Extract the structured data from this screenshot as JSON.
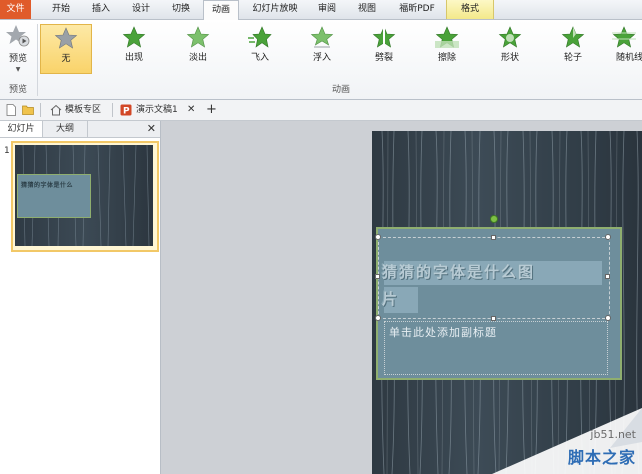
{
  "menu_tabs": [
    {
      "label": "文件"
    },
    {
      "label": "开始"
    },
    {
      "label": "插入"
    },
    {
      "label": "设计"
    },
    {
      "label": "切换"
    },
    {
      "label": "动画"
    },
    {
      "label": "幻灯片放映"
    },
    {
      "label": "审阅"
    },
    {
      "label": "视图"
    },
    {
      "label": "福昕PDF"
    },
    {
      "label": "格式"
    }
  ],
  "ribbon": {
    "preview_label": "预览",
    "preview_group": "预览",
    "animation_group": "动画",
    "effects": [
      {
        "label": "无"
      },
      {
        "label": "出现"
      },
      {
        "label": "淡出"
      },
      {
        "label": "飞入"
      },
      {
        "label": "浮入"
      },
      {
        "label": "劈裂"
      },
      {
        "label": "擦除"
      },
      {
        "label": "形状"
      },
      {
        "label": "轮子"
      },
      {
        "label": "随机线"
      }
    ],
    "colors": {
      "star": "#4aa23a",
      "star_none": "#9aa0a6",
      "selected": "#f9d36a"
    }
  },
  "doc_tabs": {
    "home_label": "模板专区",
    "doc_label": "演示文稿1",
    "add_label": "+"
  },
  "left_pane": {
    "tabs": [
      {
        "label": "幻灯片"
      },
      {
        "label": "大纲"
      }
    ],
    "close": "✕",
    "slide_number": "1",
    "thumb_title": "猜猜的字体是什么"
  },
  "slide": {
    "title_line1": "猜猜的字体是什么图",
    "title_line2": "片",
    "subtitle": "单击此处添加副标题"
  },
  "watermark": {
    "site": "jb51.net",
    "name": "脚本之家"
  }
}
